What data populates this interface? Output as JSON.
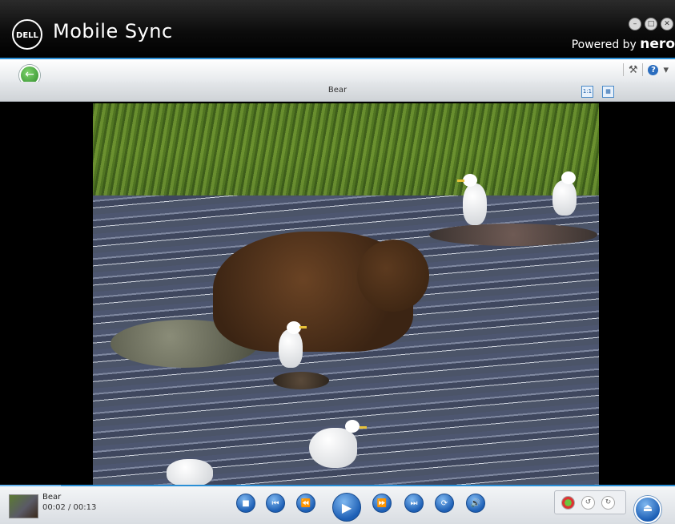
{
  "window": {
    "logo_text": "DELL",
    "title": "Mobile Sync",
    "powered_prefix": "Powered by",
    "powered_brand": "nero"
  },
  "toolbar": {
    "tool_icon": "hammer-icon",
    "help_icon": "?",
    "help_dropdown": "▾"
  },
  "viewer": {
    "title": "Bear",
    "view_single": "1:1",
    "view_grid": "grid"
  },
  "player": {
    "clip_title": "Bear",
    "time": "00:02 / 00:13",
    "progress": 0.15,
    "accent": "#2a8fd6"
  }
}
